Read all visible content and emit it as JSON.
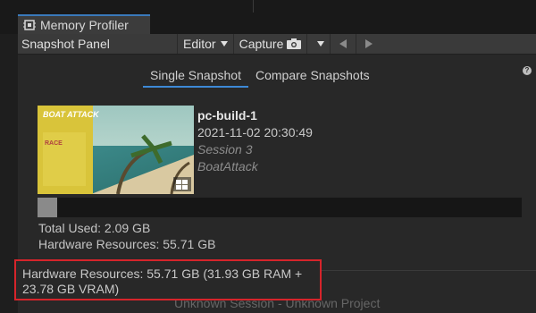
{
  "window": {
    "tab_title": "Memory Profiler"
  },
  "toolbar": {
    "panel_title": "Snapshot Panel",
    "editor_label": "Editor",
    "capture_label": "Capture",
    "camera_icon": "camera-icon",
    "prev_icon": "arrow-left-icon",
    "next_icon": "arrow-right-icon"
  },
  "tabs": {
    "single": "Single Snapshot",
    "compare": "Compare Snapshots"
  },
  "snapshot": {
    "name": "pc-build-1",
    "datetime": "2021-11-02 20:30:49",
    "session": "Session 3",
    "project": "BoatAttack",
    "thumb_title": "BOAT ATTACK",
    "thumb_race": "RACE"
  },
  "usage_fraction": 0.04,
  "stats": {
    "total_used": "Total Used: 2.09 GB",
    "hardware": "Hardware Resources: 55.71 GB"
  },
  "callout": {
    "line1": "Hardware Resources: 55.71 GB (31.93 GB RAM +",
    "line2": "23.78 GB VRAM)"
  },
  "footer": {
    "text": "Unknown Session - Unknown Project"
  },
  "colors": {
    "accent": "#3d89d6",
    "callout_border": "#d6242b"
  }
}
